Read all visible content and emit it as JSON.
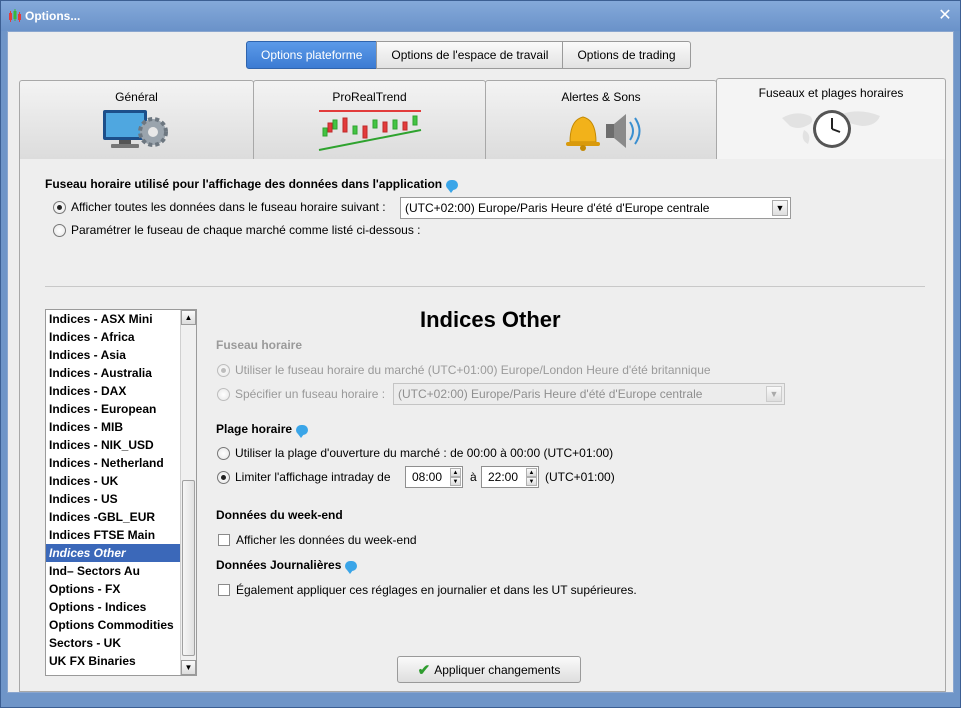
{
  "window": {
    "title": "Options...",
    "close_glyph": "✕",
    "app_icon": "candlestick-icon"
  },
  "top_tabs": [
    {
      "label": "Options plateforme",
      "active": true
    },
    {
      "label": "Options de l'espace de travail",
      "active": false
    },
    {
      "label": "Options de trading",
      "active": false
    }
  ],
  "big_tabs": [
    {
      "label": "Général",
      "icon": "computer-gear-icon",
      "active": false
    },
    {
      "label": "ProRealTrend",
      "icon": "trend-chart-icon",
      "active": false
    },
    {
      "label": "Alertes & Sons",
      "icon": "bell-speaker-icon",
      "active": false
    },
    {
      "label": "Fuseaux et plages horaires",
      "icon": "world-clock-icon",
      "active": true
    }
  ],
  "timezone_section": {
    "title": "Fuseau horaire utilisé pour l'affichage des données dans l'application",
    "option_all": "Afficher toutes les données dans le fuseau horaire suivant :",
    "option_all_selected": true,
    "timezone_value": "(UTC+02:00) Europe/Paris Heure d'été d'Europe centrale",
    "option_each": "Paramétrer le fuseau de chaque marché comme listé ci-dessous :"
  },
  "market_list": {
    "items": [
      "Indices - ASX Mini",
      "Indices - Africa",
      "Indices - Asia",
      "Indices - Australia",
      "Indices - DAX",
      "Indices - European",
      "Indices - MIB",
      "Indices - NIK_USD",
      "Indices - Netherland",
      "Indices - UK",
      "Indices - US",
      "Indices -GBL_EUR",
      "Indices FTSE Main",
      "Indices Other",
      "Ind– Sectors Au",
      "Options - FX",
      "Options - Indices",
      "Options Commodities",
      "Sectors - UK",
      "UK FX Binaries"
    ],
    "selected": "Indices Other"
  },
  "detail": {
    "title": "Indices Other",
    "fuseau_title": "Fuseau horaire",
    "fuseau_market": "Utiliser le fuseau horaire du marché (UTC+01:00) Europe/London Heure d'été britannique",
    "fuseau_specify": "Spécifier un fuseau horaire :",
    "fuseau_specify_value": "(UTC+02:00) Europe/Paris Heure d'été d'Europe centrale",
    "plage_title": "Plage horaire",
    "plage_open": "Utiliser la plage d'ouverture du marché : de 00:00 à 00:00  (UTC+01:00)",
    "plage_limit": "Limiter l'affichage intraday  de",
    "plage_from": "08:00",
    "plage_to_label": "à",
    "plage_to": "22:00",
    "plage_tz": "(UTC+01:00)",
    "weekend_title": "Données du week-end",
    "weekend_check": "Afficher les données du week-end",
    "daily_title": "Données Journalières",
    "daily_check": "Également appliquer ces réglages en journalier et dans les UT supérieures."
  },
  "apply_button": "Appliquer changements"
}
